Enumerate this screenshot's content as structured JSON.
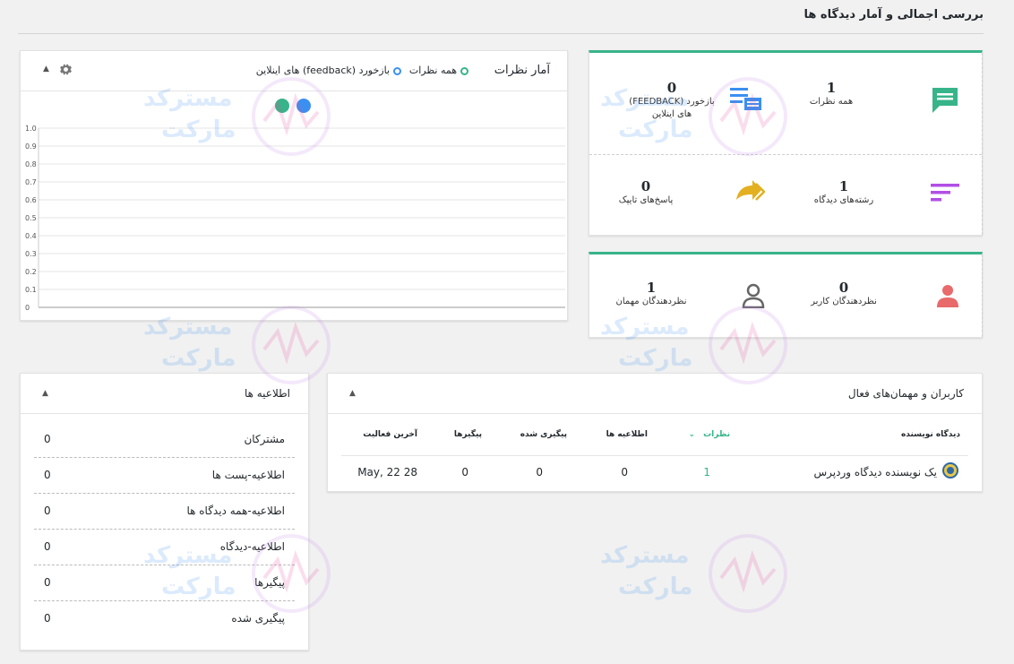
{
  "page": {
    "title": "بررسی اجمالی و آمار دیدگاه ها"
  },
  "chart_box": {
    "title": "آمار نظرات",
    "legend": [
      {
        "label": "همه نظرات",
        "color": "#37b48a"
      },
      {
        "label": "بازخورد (feedback) های اینلاین",
        "color": "#3b8ff0"
      }
    ],
    "icons": {
      "settings": "gear-icon",
      "collapse": "triangle-up-icon"
    }
  },
  "chart_data": {
    "type": "line",
    "x": [],
    "series": [
      {
        "name": "همه نظرات",
        "color": "#37b48a",
        "values": []
      },
      {
        "name": "بازخورد (feedback) های اینلاین",
        "color": "#3b8ff0",
        "values": []
      }
    ],
    "ylim": [
      0,
      1.0
    ],
    "yticks": [
      "1.0",
      "0.9",
      "0.8",
      "0.7",
      "0.6",
      "0.5",
      "0.4",
      "0.3",
      "0.2",
      "0.1",
      "0"
    ],
    "grid": true,
    "legend_position": "top"
  },
  "stats": {
    "all_comments": {
      "value": "1",
      "label": "همه نظرات",
      "icon": "comment-icon",
      "color": "#37b48a"
    },
    "inline_feedback": {
      "value": "0",
      "label": "بازخورد (FEEDBACK) های اینلاین",
      "icon": "feedback-list-icon",
      "color": "#3b8ff0"
    },
    "threads": {
      "value": "1",
      "label": "رشته‌های دیدگاه",
      "icon": "threads-icon",
      "color": "#b14fe6"
    },
    "replies": {
      "value": "0",
      "label": "پاسخ‌های تایپک",
      "icon": "replies-icon",
      "color": "#e2b020"
    }
  },
  "users": {
    "user_commenters": {
      "value": "0",
      "label": "نظردهندگان کاربر",
      "icon": "user-icon",
      "color": "#e86a6a"
    },
    "guest_commenters": {
      "value": "1",
      "label": "نظردهندگان مهمان",
      "icon": "guest-icon",
      "color": "#666666"
    }
  },
  "notifications": {
    "title": "اطلاعیه ها",
    "rows": [
      {
        "label": "مشترکان",
        "value": "0"
      },
      {
        "label": "اطلاعیه-پست ها",
        "value": "0"
      },
      {
        "label": "اطلاعیه-همه دیدگاه ها",
        "value": "0"
      },
      {
        "label": "اطلاعیه-دیدگاه",
        "value": "0"
      },
      {
        "label": "پیگیرها",
        "value": "0"
      },
      {
        "label": "پیگیری شده",
        "value": "0"
      }
    ]
  },
  "active_users": {
    "title": "کاربران و مهمان‌های فعال",
    "columns": {
      "author": "دیدگاه نویسنده",
      "comments": "نظرات",
      "notifications": "اطلاعیه ها",
      "followed": "پیگیری شده",
      "followers": "پیگیرها",
      "last_activity": "آخرین فعالیت"
    },
    "rows": [
      {
        "author": "یک نویسنده دیدگاه وردپرس",
        "comments": "1",
        "notifications": "0",
        "followed": "0",
        "followers": "0",
        "last_activity": "May, 22 28"
      }
    ]
  },
  "watermark": {
    "line1": "مسترکد",
    "line2": "مارکت"
  }
}
